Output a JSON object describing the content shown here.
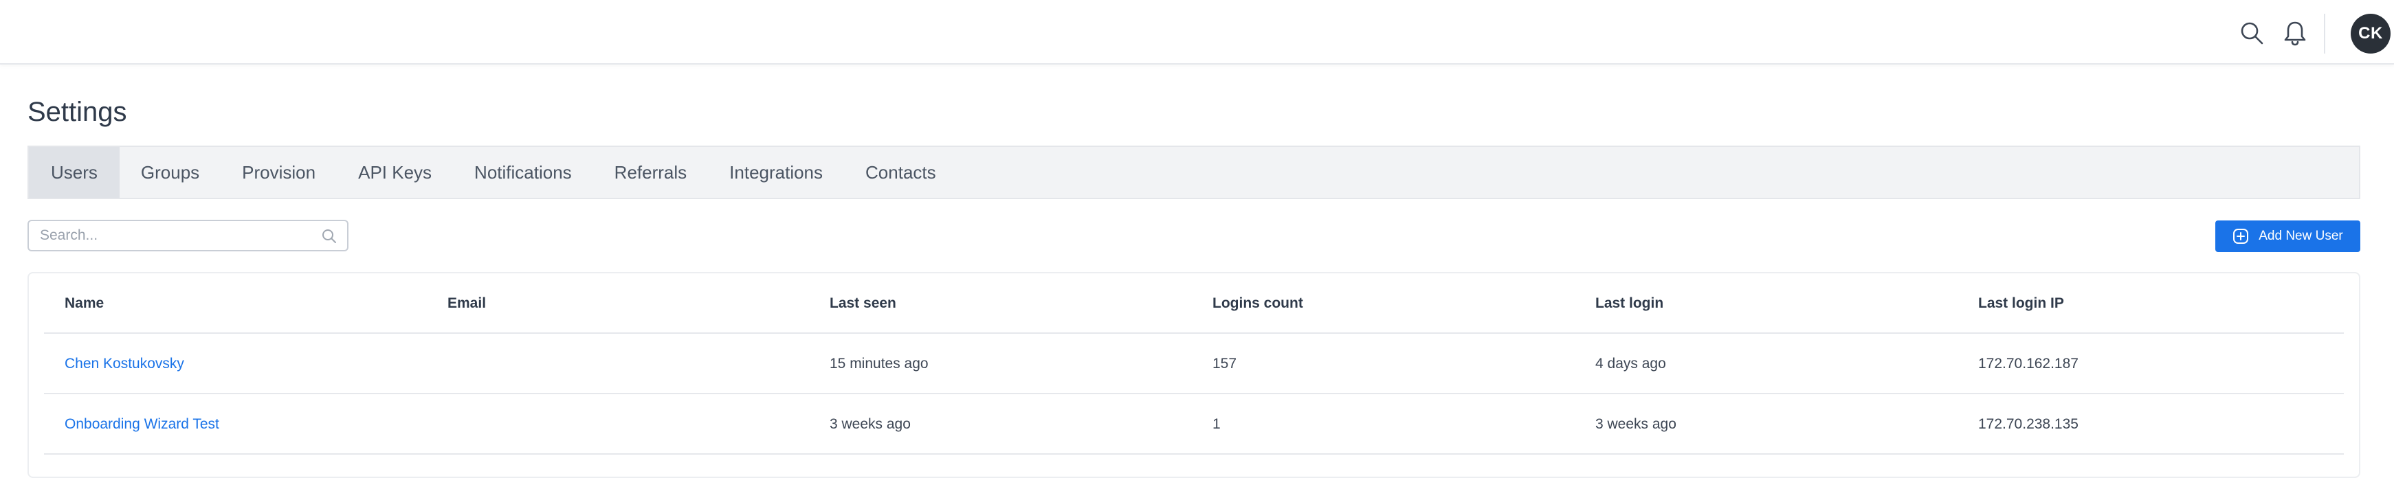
{
  "header": {
    "search_icon": "search-icon",
    "bell_icon": "bell-icon",
    "avatar_initials": "CK"
  },
  "page": {
    "title": "Settings"
  },
  "tabs": [
    {
      "label": "Users",
      "active": true
    },
    {
      "label": "Groups",
      "active": false
    },
    {
      "label": "Provision",
      "active": false
    },
    {
      "label": "API Keys",
      "active": false
    },
    {
      "label": "Notifications",
      "active": false
    },
    {
      "label": "Referrals",
      "active": false
    },
    {
      "label": "Integrations",
      "active": false
    },
    {
      "label": "Contacts",
      "active": false
    }
  ],
  "search": {
    "placeholder": "Search...",
    "value": ""
  },
  "toolbar": {
    "add_user_label": "Add New User"
  },
  "colors": {
    "accent": "#1a73e8",
    "avatar_bg": "#2a3038",
    "tab_bar_bg": "#f2f3f5",
    "tab_active_bg": "#dfe2e7"
  },
  "table": {
    "columns": [
      "Name",
      "Email",
      "Last seen",
      "Logins count",
      "Last login",
      "Last login IP"
    ],
    "rows": [
      {
        "name": "Chen Kostukovsky",
        "email": "",
        "last_seen": "15 minutes ago",
        "logins_count": "157",
        "last_login": "4 days ago",
        "last_login_ip": "172.70.162.187"
      },
      {
        "name": "Onboarding Wizard Test",
        "email": "",
        "last_seen": "3 weeks ago",
        "logins_count": "1",
        "last_login": "3 weeks ago",
        "last_login_ip": "172.70.238.135"
      }
    ]
  }
}
